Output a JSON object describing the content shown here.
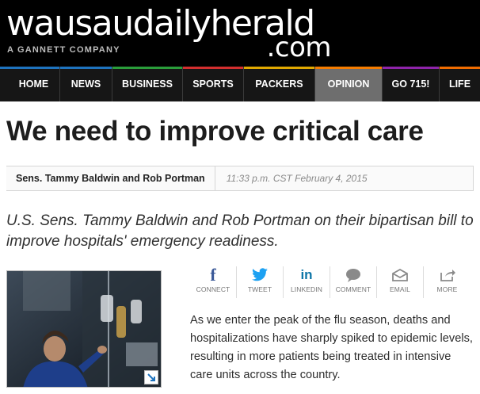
{
  "masthead": {
    "logo_main": "wausaudailyherald",
    "logo_dotcom": ".com",
    "logo_sub": "A GANNETT COMPANY"
  },
  "nav": {
    "items": [
      {
        "label": "HOME",
        "accent": "#1e73be"
      },
      {
        "label": "NEWS",
        "accent": "#1e73be"
      },
      {
        "label": "BUSINESS",
        "accent": "#2a9d3a"
      },
      {
        "label": "SPORTS",
        "accent": "#d32f2f"
      },
      {
        "label": "PACKERS",
        "accent": "#e0a800"
      },
      {
        "label": "OPINION",
        "accent": "#f57c00"
      },
      {
        "label": "GO 715!",
        "accent": "#8e24aa"
      },
      {
        "label": "LIFE",
        "accent": "#ef6c00"
      }
    ],
    "active": "OPINION"
  },
  "article": {
    "headline": "We need to improve critical care",
    "author": "Sens. Tammy Baldwin and Rob Portman",
    "timestamp": "11:33 p.m. CST February 4, 2015",
    "summary": "U.S. Sens. Tammy Baldwin and Rob Portman on their bipartisan bill to improve hospitals' emergency readiness.",
    "body": "As we enter the peak of the flu season, deaths and hospitalizations have sharply spiked to epidemic levels, resulting in more patients being treated in intensive care units across the country."
  },
  "share": {
    "items": [
      {
        "label": "CONNECT",
        "icon": "facebook-icon",
        "color": "#3b5998"
      },
      {
        "label": "TWEET",
        "icon": "twitter-icon",
        "color": "#1da1f2"
      },
      {
        "label": "LINKEDIN",
        "icon": "linkedin-icon",
        "color": "#0e76a8"
      },
      {
        "label": "COMMENT",
        "icon": "comment-icon",
        "color": "#8a8a8a"
      },
      {
        "label": "EMAIL",
        "icon": "email-icon",
        "color": "#8a8a8a"
      },
      {
        "label": "MORE",
        "icon": "share-icon",
        "color": "#8a8a8a"
      }
    ]
  },
  "photo": {
    "expand_icon": "expand-icon"
  }
}
